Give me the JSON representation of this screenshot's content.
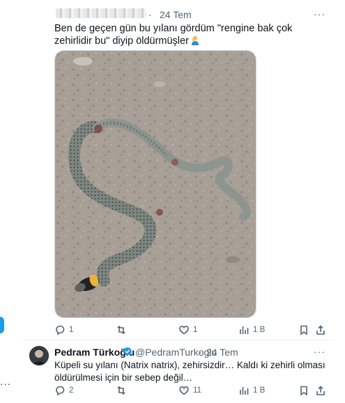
{
  "reply1": {
    "time": "24 Tem",
    "text": "Ben de geçen gün bu yılanı gördüm \"rengine bak çok zehirlidir bu\" diyip öldürmüşler",
    "emoji": "person-facepalming",
    "actions": {
      "replies": "1",
      "retweets": "",
      "likes": "1",
      "views": "1 B"
    }
  },
  "reply2": {
    "name": "Pedram Türkoğlu",
    "handle": "@PedramTurkoglu",
    "time": "24 Tem",
    "text": "Küpeli su yılanı (Natrix natrix), zehirsizdir… Kaldı ki zehirli olması öldürülmesi için bir sebep değil…",
    "actions": {
      "replies": "2",
      "retweets": "",
      "likes": "11",
      "views": "1 B"
    }
  },
  "separator": "·",
  "more": "···",
  "colors": {
    "accent": "#1d9bf0",
    "muted": "#536471",
    "text": "#0f1419",
    "border": "#eff3f4"
  }
}
